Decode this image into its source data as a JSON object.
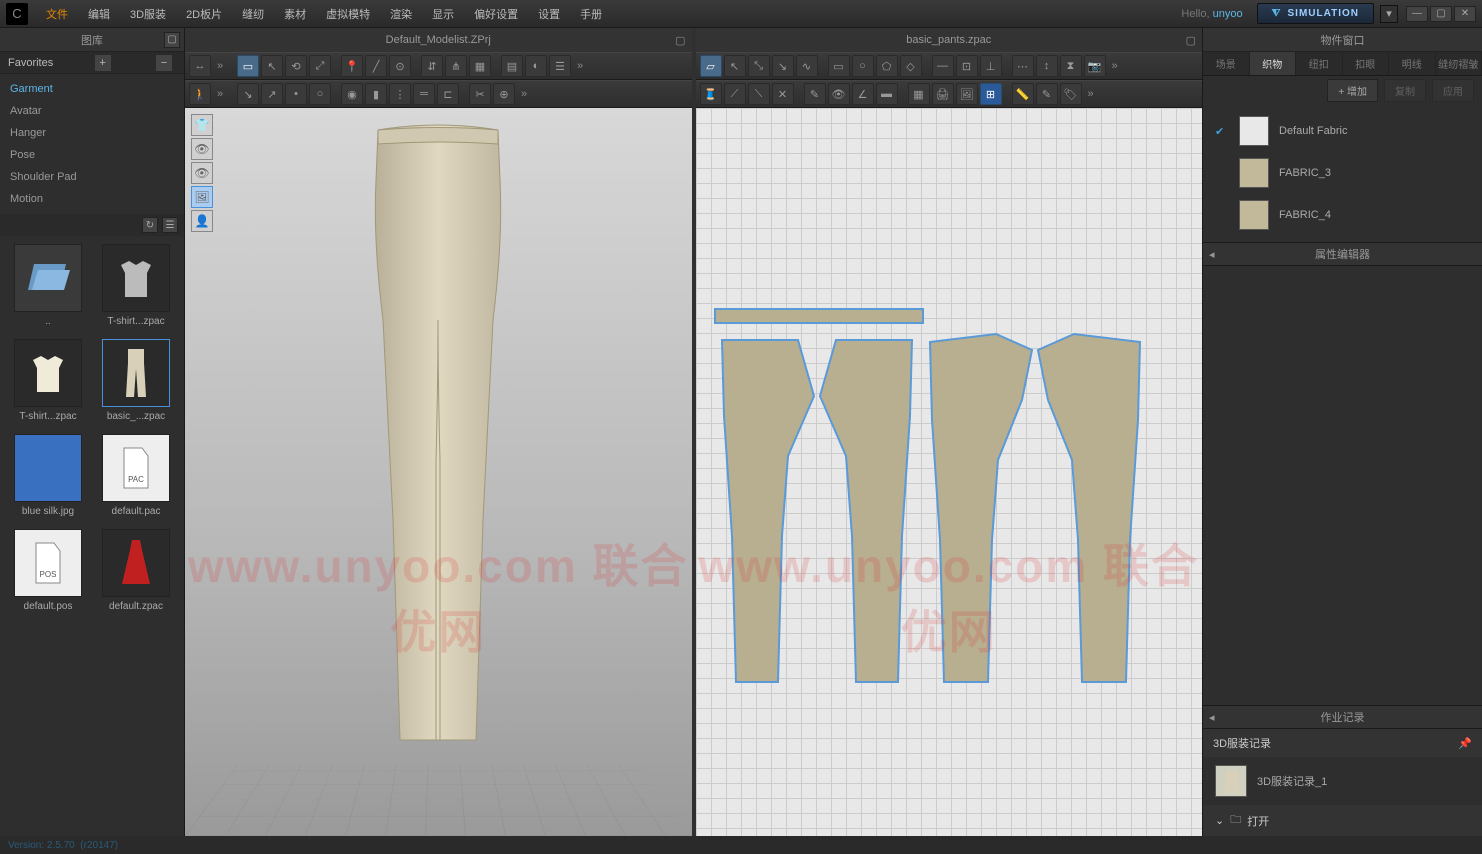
{
  "menubar": {
    "items": [
      "文件",
      "编辑",
      "3D服装",
      "2D板片",
      "缝纫",
      "素材",
      "虚拟模特",
      "渲染",
      "显示",
      "偏好设置",
      "设置",
      "手册"
    ],
    "hello_prefix": "Hello,",
    "username": "unyoo",
    "simulation_label": "SIMULATION"
  },
  "left": {
    "panel_title": "图库",
    "favorites_label": "Favorites",
    "categories": [
      "Garment",
      "Avatar",
      "Hanger",
      "Pose",
      "Shoulder Pad",
      "Motion"
    ],
    "selected_category": 0,
    "library_items": [
      {
        "label": "..",
        "kind": "folder"
      },
      {
        "label": "T-shirt...zpac",
        "kind": "tshirt-dark"
      },
      {
        "label": "T-shirt...zpac",
        "kind": "tshirt-light"
      },
      {
        "label": "basic_...zpac",
        "kind": "pants",
        "selected": true
      },
      {
        "label": "blue silk.jpg",
        "kind": "blue"
      },
      {
        "label": "default.pac",
        "kind": "pac"
      },
      {
        "label": "default.pos",
        "kind": "pos"
      },
      {
        "label": "default.zpac",
        "kind": "dress"
      }
    ]
  },
  "viewports": {
    "left_title": "Default_Modelist.ZPrj",
    "right_title": "basic_pants.zpac"
  },
  "watermark": "www.unyoo.com 联合优网",
  "right": {
    "panel_title": "物件窗口",
    "tabs": [
      "场景",
      "织物",
      "纽扣",
      "扣眼",
      "明线",
      "缝纫褶皱"
    ],
    "active_tab": 1,
    "add_label": "+ 增加",
    "copy_label": "复制",
    "apply_label": "应用",
    "fabrics": [
      {
        "name": "Default Fabric",
        "color": "#e8e8e8",
        "checked": true
      },
      {
        "name": "FABRIC_3",
        "color": "#c2b99a",
        "checked": false
      },
      {
        "name": "FABRIC_4",
        "color": "#c2b99a",
        "checked": false
      }
    ],
    "prop_editor_title": "属性编辑器",
    "history_panel_title": "作业记录",
    "history_title": "3D服装记录",
    "history_items": [
      {
        "name": "3D服装记录_1"
      }
    ],
    "open_label": "打开"
  },
  "footer": {
    "version": "Version: 2.5.70",
    "build": "(r20147)"
  }
}
